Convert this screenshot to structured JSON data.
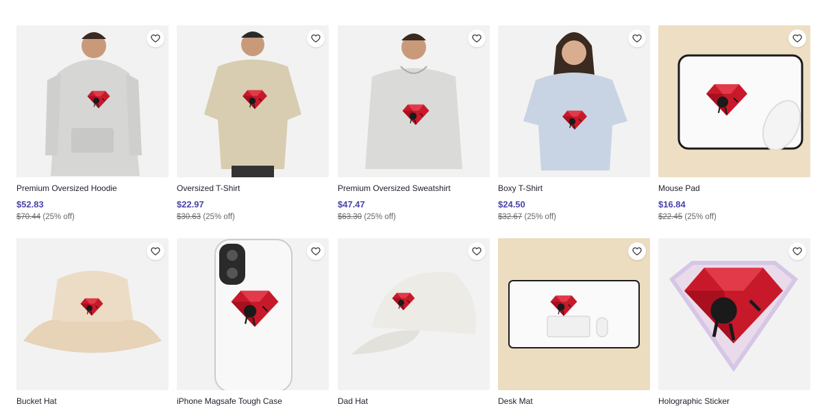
{
  "products": [
    {
      "name": "Premium Oversized Hoodie",
      "price": "$52.83",
      "original_price": "$70.44",
      "discount": "(25% off)"
    },
    {
      "name": "Oversized T-Shirt",
      "price": "$22.97",
      "original_price": "$30.63",
      "discount": "(25% off)"
    },
    {
      "name": "Premium Oversized Sweatshirt",
      "price": "$47.47",
      "original_price": "$63.30",
      "discount": "(25% off)"
    },
    {
      "name": "Boxy T-Shirt",
      "price": "$24.50",
      "original_price": "$32.67",
      "discount": "(25% off)"
    },
    {
      "name": "Mouse Pad",
      "price": "$16.84",
      "original_price": "$22.45",
      "discount": "(25% off)"
    },
    {
      "name": "Bucket Hat"
    },
    {
      "name": "iPhone Magsafe Tough Case"
    },
    {
      "name": "Dad Hat"
    },
    {
      "name": "Desk Mat"
    },
    {
      "name": "Holographic Sticker"
    }
  ],
  "icons": {
    "favorite": "heart-outline-icon"
  },
  "colors": {
    "price": "#4a44a8",
    "ruby": "#c8192a"
  }
}
